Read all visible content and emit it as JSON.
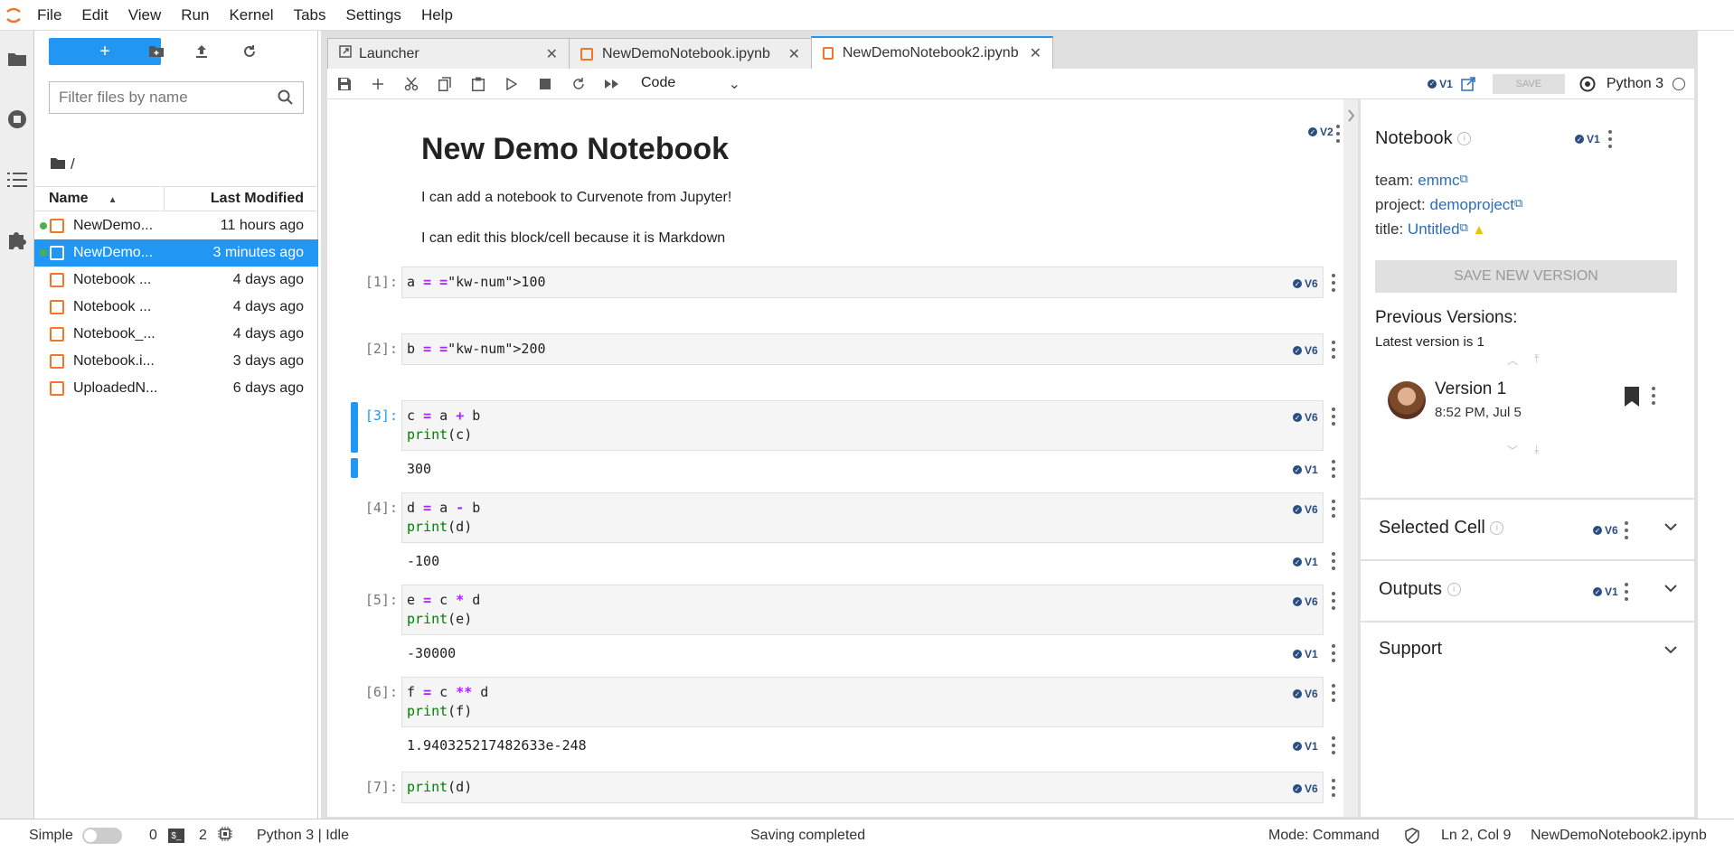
{
  "menu": [
    "File",
    "Edit",
    "View",
    "Run",
    "Kernel",
    "Tabs",
    "Settings",
    "Help"
  ],
  "filebrowser": {
    "filter_placeholder": "Filter files by name",
    "path": "/",
    "col_name": "Name",
    "col_modified": "Last Modified",
    "files": [
      {
        "name": "NewDemo...",
        "modified": "11 hours ago",
        "running": true,
        "selected": false
      },
      {
        "name": "NewDemo...",
        "modified": "3 minutes ago",
        "running": true,
        "selected": true
      },
      {
        "name": "Notebook ...",
        "modified": "4 days ago",
        "running": false,
        "selected": false
      },
      {
        "name": "Notebook ...",
        "modified": "4 days ago",
        "running": false,
        "selected": false
      },
      {
        "name": "Notebook_...",
        "modified": "4 days ago",
        "running": false,
        "selected": false
      },
      {
        "name": "Notebook.i...",
        "modified": "3 days ago",
        "running": false,
        "selected": false
      },
      {
        "name": "UploadedN...",
        "modified": "6 days ago",
        "running": false,
        "selected": false
      }
    ]
  },
  "tabs": [
    {
      "label": "Launcher"
    },
    {
      "label": "NewDemoNotebook.ipynb"
    },
    {
      "label": "NewDemoNotebook2.ipynb"
    }
  ],
  "toolbar": {
    "cell_type": "Code",
    "version": "V1",
    "save_label": "SAVE",
    "kernel": "Python 3"
  },
  "notebook": {
    "title": "New Demo Notebook",
    "title_version": "V2",
    "md_line1": "I can add a notebook to Curvenote from Jupyter!",
    "md_line2": "I can edit this block/cell because it is Markdown",
    "cells": [
      {
        "prompt": "[1]:",
        "code_lines": [
          "a = 100"
        ],
        "version": "V6",
        "output": null
      },
      {
        "prompt": "[2]:",
        "code_lines": [
          "b = 200"
        ],
        "version": "V6",
        "output": null
      },
      {
        "prompt": "[3]:",
        "code_lines": [
          "c = a + b",
          "print(c)"
        ],
        "version": "V6",
        "output": "300",
        "output_version": "V1"
      },
      {
        "prompt": "[4]:",
        "code_lines": [
          "d = a - b",
          "print(d)"
        ],
        "version": "V6",
        "output": "-100",
        "output_version": "V1"
      },
      {
        "prompt": "[5]:",
        "code_lines": [
          "e = c * d",
          "print(e)"
        ],
        "version": "V6",
        "output": "-30000",
        "output_version": "V1"
      },
      {
        "prompt": "[6]:",
        "code_lines": [
          "f = c ** d",
          "print(f)"
        ],
        "version": "V6",
        "output": "1.940325217482633e-248",
        "output_version": "V1"
      },
      {
        "prompt": "[7]:",
        "code_lines": [
          "print(d)"
        ],
        "version": "V6",
        "output": null
      }
    ]
  },
  "side": {
    "notebook_title": "Notebook",
    "notebook_version": "V1",
    "team_label": "team:",
    "team": "emmc",
    "project_label": "project:",
    "project": "demoproject",
    "title_label": "title:",
    "title": "Untitled",
    "save_new_version": "SAVE NEW VERSION",
    "prev_versions": "Previous Versions:",
    "latest": "Latest version is 1",
    "version_name": "Version 1",
    "version_date": "8:52 PM, Jul 5",
    "selected_cell": "Selected Cell",
    "selected_cell_version": "V6",
    "outputs": "Outputs",
    "outputs_version": "V1",
    "support": "Support"
  },
  "status": {
    "mode_simple": "Simple",
    "count0": "0",
    "count2": "2",
    "kernel_status": "Python 3 | Idle",
    "message": "Saving completed",
    "mode": "Mode: Command",
    "cursor": "Ln 2, Col 9",
    "file": "NewDemoNotebook2.ipynb"
  },
  "colors": {
    "accent": "#2196f3",
    "jupyter_orange": "#f37626",
    "badge": "#2a4d80"
  }
}
